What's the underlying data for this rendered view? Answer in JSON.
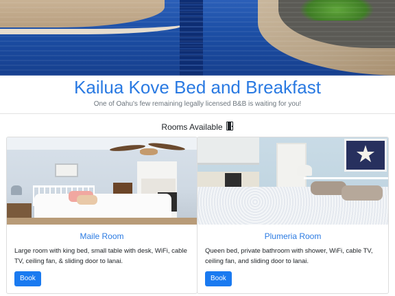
{
  "header": {
    "title": "Kailua Kove Bed and Breakfast",
    "subtitle": "One of Oahu's few remaining legally licensed B&B is waiting for you!"
  },
  "rooms_section": {
    "heading": "Rooms Available",
    "heading_icon": "door-icon"
  },
  "rooms": [
    {
      "name": "Maile Room",
      "description": "Large room with king bed, small table with desk, WiFi, cable TV, ceiling fan, & sliding door to lanai.",
      "button_label": "Book"
    },
    {
      "name": "Plumeria Room",
      "description": "Queen bed, private bathroom with shower, WiFi, cable TV, ceiling fan, and sliding door to lanai.",
      "button_label": "Book"
    }
  ],
  "colors": {
    "accent": "#2a7ae2",
    "button": "#1a7af0",
    "muted_text": "#6c757d"
  }
}
